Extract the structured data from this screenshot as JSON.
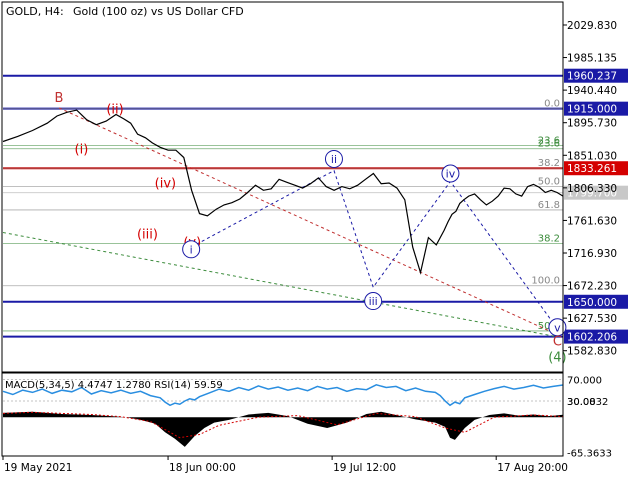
{
  "header": {
    "symbol": "GOLD, H4:",
    "description": "Gold (100 oz) vs US Dollar CFD"
  },
  "chart_data": [
    {
      "type": "line",
      "panel": "price",
      "symbol": "GOLD",
      "timeframe": "H4",
      "ylim": [
        1555,
        2060
      ],
      "y_ticks": [
        2029.83,
        1985.135,
        1940.44,
        1895.73,
        1851.03,
        1806.33,
        1761.63,
        1716.93,
        1672.23,
        1627.53,
        1582.83
      ],
      "x_ticks": [
        "19 May 2021",
        "18 Jun 00:00",
        "19 Jul 12:00",
        "17 Aug 20:00"
      ],
      "x_tick_index": [
        0,
        168,
        335,
        502
      ],
      "x_range": [
        0,
        570
      ],
      "series": [
        {
          "index": [
            0,
            15,
            30,
            45,
            55,
            65,
            75,
            85,
            95,
            105,
            115,
            123,
            130,
            137,
            145,
            152,
            160,
            168,
            176,
            184,
            192,
            200,
            208,
            217,
            225,
            233,
            241,
            249,
            257,
            265,
            273,
            281,
            289,
            297,
            305,
            313,
            321,
            329,
            337,
            345,
            353,
            361,
            369,
            377,
            385,
            393,
            401,
            409,
            417,
            425,
            433,
            441,
            449,
            453,
            457,
            461,
            465,
            469,
            474,
            480,
            486,
            492,
            498,
            504,
            510,
            516,
            522,
            528,
            534,
            540,
            546,
            552,
            558,
            564,
            570
          ],
          "close": [
            1870,
            1877,
            1885,
            1895,
            1905,
            1910,
            1913,
            1900,
            1893,
            1898,
            1907,
            1901,
            1895,
            1880,
            1875,
            1868,
            1862,
            1858,
            1858,
            1848,
            1803,
            1771,
            1768,
            1777,
            1783,
            1786,
            1791,
            1800,
            1810,
            1803,
            1805,
            1818,
            1814,
            1810,
            1806,
            1812,
            1820,
            1808,
            1803,
            1808,
            1805,
            1810,
            1818,
            1826,
            1812,
            1813,
            1806,
            1790,
            1725,
            1690,
            1738,
            1728,
            1748,
            1760,
            1770,
            1774,
            1785,
            1790,
            1795,
            1798,
            1790,
            1783,
            1788,
            1795,
            1806,
            1805,
            1798,
            1795,
            1808,
            1811,
            1807,
            1800,
            1803,
            1800,
            1795
          ]
        }
      ],
      "levels": [
        {
          "label": "1960.237",
          "value": 1960.237,
          "color": "#1a1aa6",
          "style": "solid"
        },
        {
          "label": "1915.000",
          "value": 1915.0,
          "color": "#1a1aa6",
          "style": "solid"
        },
        {
          "label": "1833.261",
          "value": 1833.261,
          "color": "#d40000",
          "style": "solid"
        },
        {
          "label": "1799.700",
          "value": 1799.7,
          "color": "#b0b0b0",
          "style": "current-price"
        },
        {
          "label": "1650.000",
          "value": 1650.0,
          "color": "#1a1aa6",
          "style": "solid"
        },
        {
          "label": "1602.206",
          "value": 1602.206,
          "color": "#1a1aa6",
          "style": "solid"
        }
      ],
      "fib_upper": [
        {
          "label": "0.0",
          "value": 1915.0,
          "color": "#888888"
        },
        {
          "label": "23.6",
          "value": 1864.5,
          "color": "#3c8c3c"
        },
        {
          "label": "23.6",
          "value": 1860.0,
          "color": "#3c8c3c"
        },
        {
          "label": "38.2",
          "value": 1833.3,
          "color": "#888888"
        },
        {
          "label": "50.0",
          "value": 1808.0,
          "color": "#888888"
        },
        {
          "label": "61.8",
          "value": 1776.0,
          "color": "#888888"
        }
      ],
      "fib_lower": [
        {
          "label": "38.2",
          "value": 1730.0,
          "color": "#3c8c3c"
        },
        {
          "label": "100.0",
          "value": 1672.0,
          "color": "#888888"
        },
        {
          "label": "50.0",
          "value": 1610.0,
          "color": "#3c8c3c"
        }
      ],
      "wave_labels": [
        {
          "text": "B",
          "i": 100,
          "y": 1931,
          "color": "#c03030",
          "circle": false
        },
        {
          "text": "(ii)",
          "i": 200,
          "y": 1915,
          "color": "#d40000",
          "circle": false
        },
        {
          "text": "(i)",
          "i": 140,
          "y": 1860,
          "color": "#d40000",
          "circle": false
        },
        {
          "text": "(iv)",
          "i": 290,
          "y": 1814,
          "color": "#d40000",
          "circle": false
        },
        {
          "text": "(iii)",
          "i": 258,
          "y": 1744,
          "color": "#d40000",
          "circle": false
        },
        {
          "text": "(v)",
          "i": 338,
          "y": 1733,
          "color": "#d40000",
          "circle": false
        },
        {
          "text": "i",
          "i": 336,
          "y": 1722,
          "color": "#1a1aa6",
          "circle": true
        },
        {
          "text": "ii",
          "i": 591,
          "y": 1846,
          "color": "#1a1aa6",
          "circle": true
        },
        {
          "text": "iii",
          "i": 661,
          "y": 1651,
          "color": "#1a1aa6",
          "circle": true
        },
        {
          "text": "iv",
          "i": 799,
          "y": 1826,
          "color": "#1a1aa6",
          "circle": true
        },
        {
          "text": "v",
          "i": 990,
          "y": 1615,
          "color": "#1a1aa6",
          "circle": true
        },
        {
          "text": "C",
          "i": 990,
          "y": 1597,
          "color": "#c03030",
          "circle": false
        },
        {
          "text": "(4)",
          "i": 990,
          "y": 1575,
          "color": "#3c8c3c",
          "circle": false
        }
      ],
      "wave_paths": [
        {
          "color": "#c03030",
          "style": "dashed",
          "points": [
            [
              100,
              1916
            ],
            [
              990,
              1605
            ]
          ]
        },
        {
          "color": "#3c8c3c",
          "style": "dashed",
          "points": [
            [
              0,
              1745
            ],
            [
              990,
              1602
            ]
          ]
        },
        {
          "color": "#1a1aa6",
          "style": "dashed",
          "points": [
            [
              336,
              1725
            ],
            [
              591,
              1830
            ],
            [
              661,
              1670
            ],
            [
              799,
              1815
            ],
            [
              990,
              1613
            ]
          ]
        }
      ]
    },
    {
      "type": "line",
      "panel": "indicator",
      "title": "MACD(5,34,5) 4.4747 1.2780 RSI(14) 59.59",
      "ylim": [
        -70,
        80
      ],
      "y_ticks": [
        30.0832,
        70.0,
        30.0,
        -65.3633
      ],
      "y_tick_labels": [
        "30.0832",
        "70.000",
        "30.00",
        "-65.3633"
      ],
      "x_range": [
        0,
        570
      ],
      "series": [
        {
          "name": "MACD",
          "type": "histogram",
          "index": [
            0,
            30,
            60,
            90,
            110,
            125,
            140,
            155,
            165,
            175,
            185,
            195,
            205,
            215,
            230,
            250,
            270,
            290,
            310,
            330,
            350,
            370,
            385,
            400,
            420,
            440,
            450,
            455,
            460,
            470,
            480,
            495,
            510,
            525,
            540,
            555,
            570
          ],
          "values": [
            8,
            10,
            6,
            4,
            2,
            0,
            -5,
            -12,
            -28,
            -40,
            -55,
            -35,
            -20,
            -10,
            -5,
            5,
            8,
            2,
            -12,
            -20,
            -10,
            6,
            10,
            4,
            -4,
            -10,
            -18,
            -38,
            -42,
            -20,
            -5,
            4,
            7,
            3,
            5,
            2,
            4.47
          ]
        },
        {
          "name": "Signal",
          "type": "line",
          "index": [
            0,
            30,
            60,
            90,
            120,
            150,
            180,
            200,
            220,
            260,
            300,
            340,
            380,
            420,
            450,
            470,
            500,
            540,
            570
          ],
          "values": [
            7,
            9,
            7,
            5,
            1,
            -8,
            -38,
            -32,
            -15,
            0,
            3,
            -14,
            7,
            1,
            -20,
            -28,
            0,
            4,
            1.28
          ]
        },
        {
          "name": "RSI",
          "type": "line",
          "index": [
            0,
            10,
            20,
            30,
            40,
            50,
            60,
            70,
            80,
            90,
            100,
            110,
            120,
            130,
            140,
            150,
            160,
            165,
            170,
            175,
            180,
            185,
            190,
            195,
            200,
            210,
            220,
            230,
            240,
            250,
            260,
            270,
            280,
            290,
            300,
            310,
            320,
            330,
            340,
            350,
            360,
            370,
            380,
            390,
            400,
            410,
            420,
            430,
            440,
            445,
            450,
            455,
            460,
            465,
            470,
            480,
            490,
            500,
            510,
            520,
            530,
            540,
            550,
            560,
            570
          ],
          "values": [
            48,
            42,
            50,
            46,
            52,
            44,
            50,
            47,
            55,
            43,
            49,
            45,
            50,
            44,
            48,
            40,
            36,
            28,
            22,
            26,
            24,
            30,
            34,
            32,
            38,
            45,
            52,
            48,
            55,
            50,
            58,
            52,
            56,
            50,
            54,
            49,
            57,
            52,
            55,
            48,
            53,
            51,
            60,
            55,
            57,
            49,
            54,
            48,
            46,
            40,
            30,
            22,
            28,
            25,
            36,
            42,
            48,
            53,
            57,
            52,
            55,
            59,
            54,
            57,
            59.59
          ]
        }
      ]
    }
  ]
}
